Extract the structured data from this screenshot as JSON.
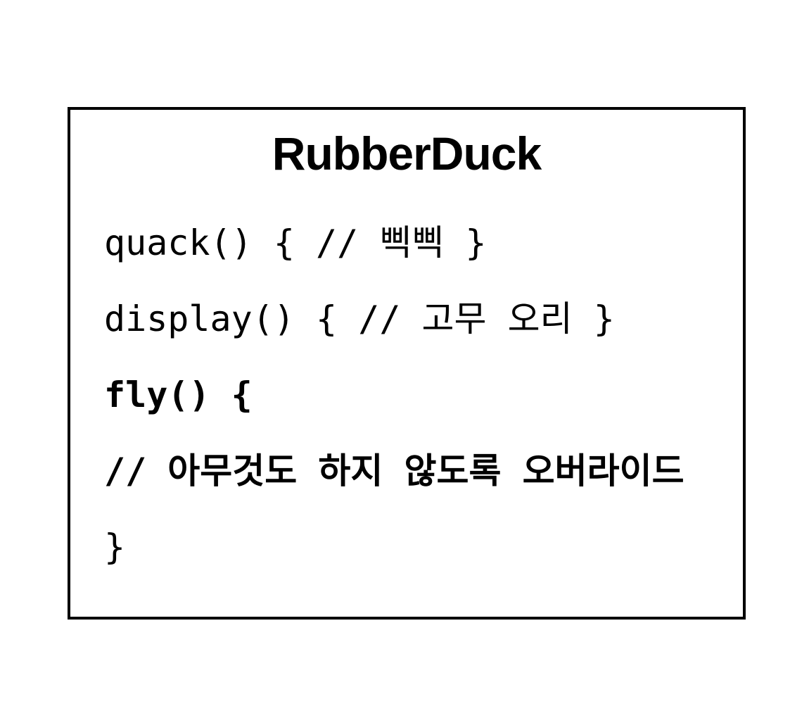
{
  "diagram": {
    "class_name": "RubberDuck",
    "methods": [
      {
        "text": "quack() { // 삑삑 }",
        "bold": false
      },
      {
        "text": "display() { // 고무 오리 }",
        "bold": false
      },
      {
        "text": "fly() {",
        "bold": true
      },
      {
        "text": "// 아무것도 하지 않도록 오버라이드",
        "bold": true
      },
      {
        "text": "}",
        "bold": false
      }
    ]
  },
  "colors": {
    "border": "#000000",
    "text": "#000000",
    "background": "#ffffff"
  }
}
